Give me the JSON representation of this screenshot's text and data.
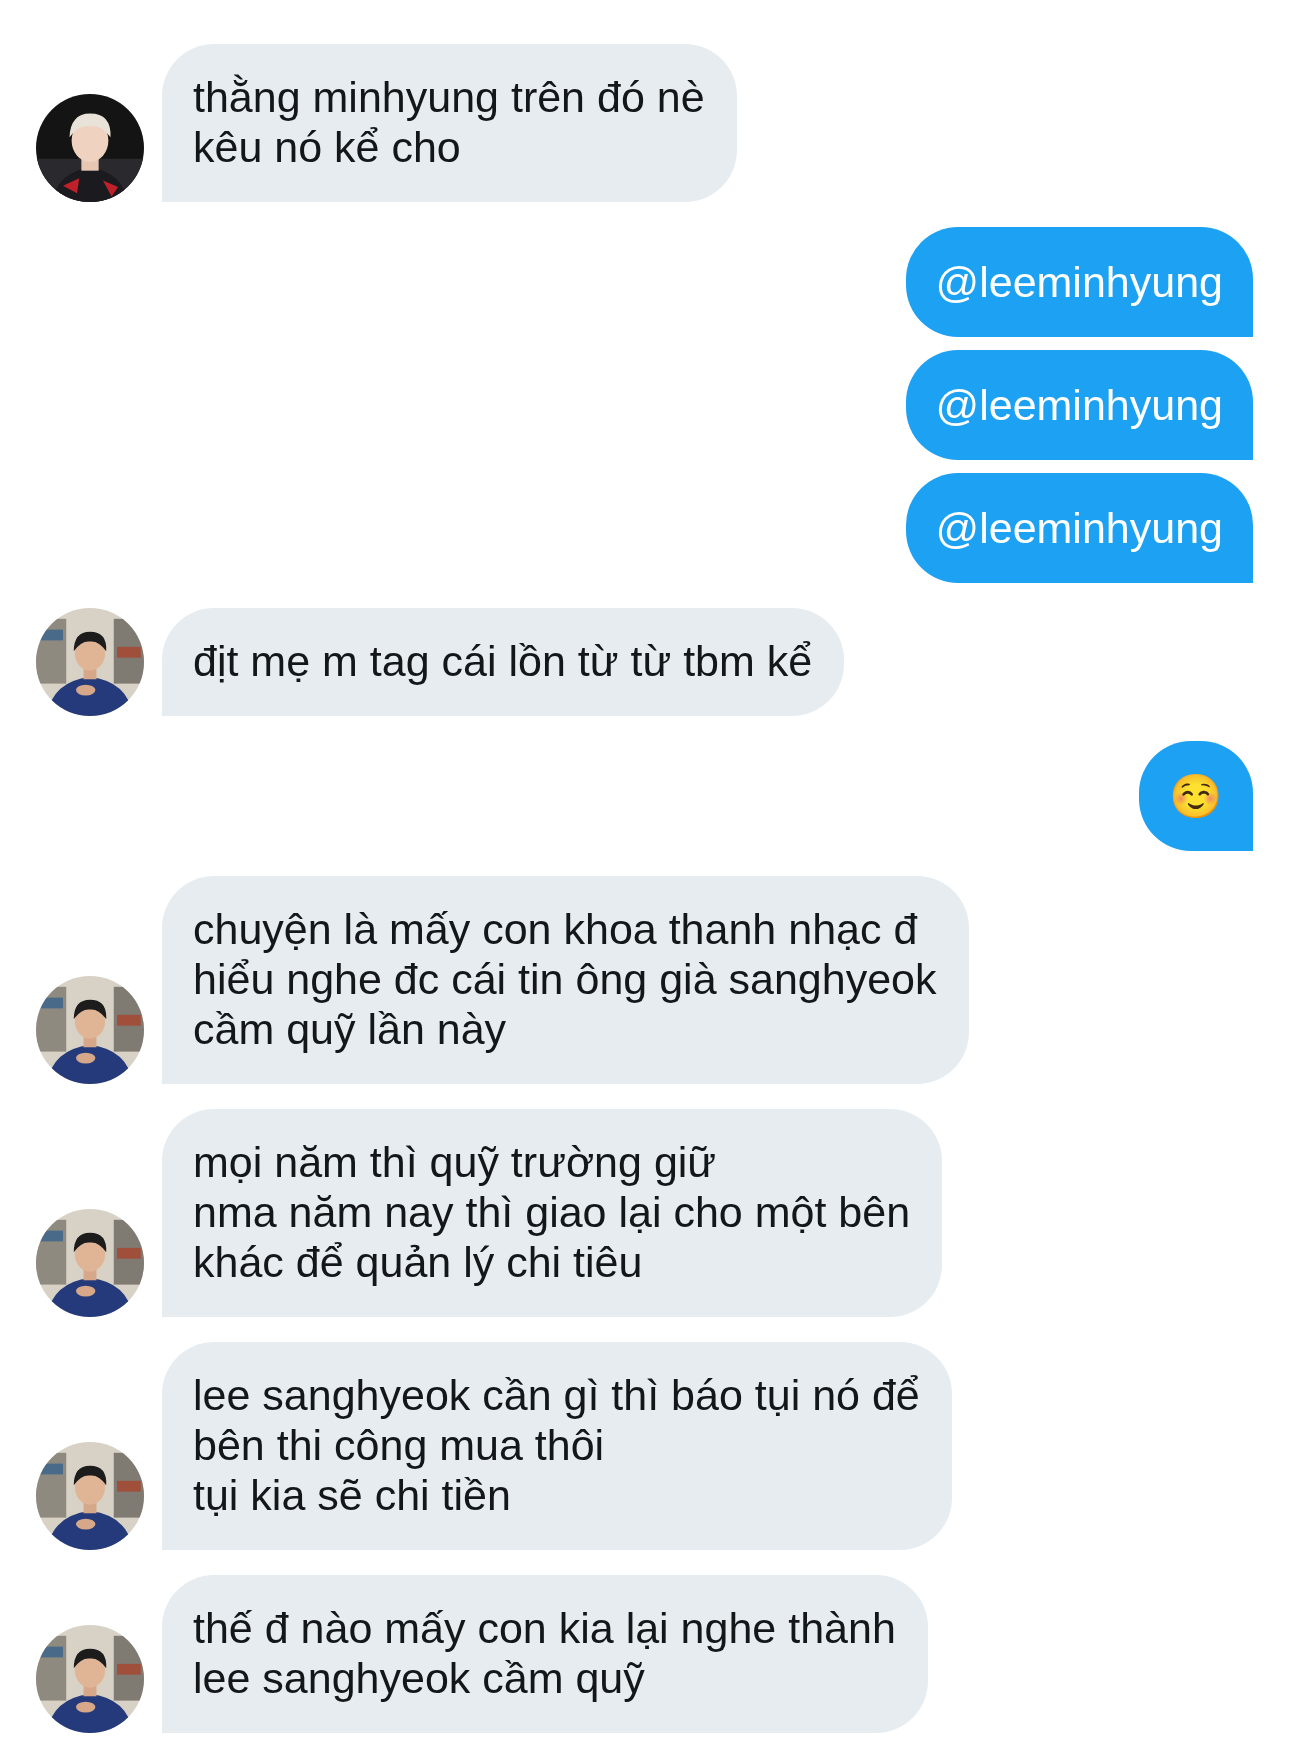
{
  "messages": [
    {
      "kind": "incoming",
      "avatar": {
        "kind": "picture"
      },
      "lines": [
        "thằng minhyung trên đó nè",
        "kêu nó kể cho"
      ]
    },
    {
      "kind": "outgoing",
      "lines": [
        "@leeminhyung"
      ]
    },
    {
      "kind": "outgoing",
      "lines": [
        "@leeminhyung"
      ]
    },
    {
      "kind": "outgoing",
      "lines": [
        "@leeminhyung"
      ]
    },
    {
      "kind": "incoming",
      "avatar": {
        "kind": "picture"
      },
      "lines": [
        "địt mẹ m tag cái lồn từ từ tbm kể"
      ]
    },
    {
      "kind": "outgoing",
      "lines": [
        "☺️"
      ]
    },
    {
      "kind": "incoming",
      "avatar": {
        "kind": "picture"
      },
      "lines": [
        "chuyện là mấy con khoa thanh nhạc đ",
        "hiểu nghe đc cái tin ông già sanghyeok",
        "cầm quỹ lần này"
      ]
    },
    {
      "kind": "incoming",
      "avatar": {
        "kind": "picture"
      },
      "lines": [
        "mọi năm thì quỹ trường giữ",
        "nma năm nay thì giao lại cho một bên",
        "khác để quản lý chi tiêu"
      ]
    },
    {
      "kind": "incoming",
      "avatar": {
        "kind": "picture"
      },
      "lines": [
        "lee sanghyeok cần gì thì báo tụi nó để",
        "bên thi công mua thôi",
        "tụi kia sẽ chi tiền"
      ]
    },
    {
      "kind": "incoming",
      "avatar": {
        "kind": "picture"
      },
      "lines": [
        "thế đ nào mấy con kia lại nghe thành",
        "lee sanghyeok cầm quỹ"
      ]
    }
  ]
}
